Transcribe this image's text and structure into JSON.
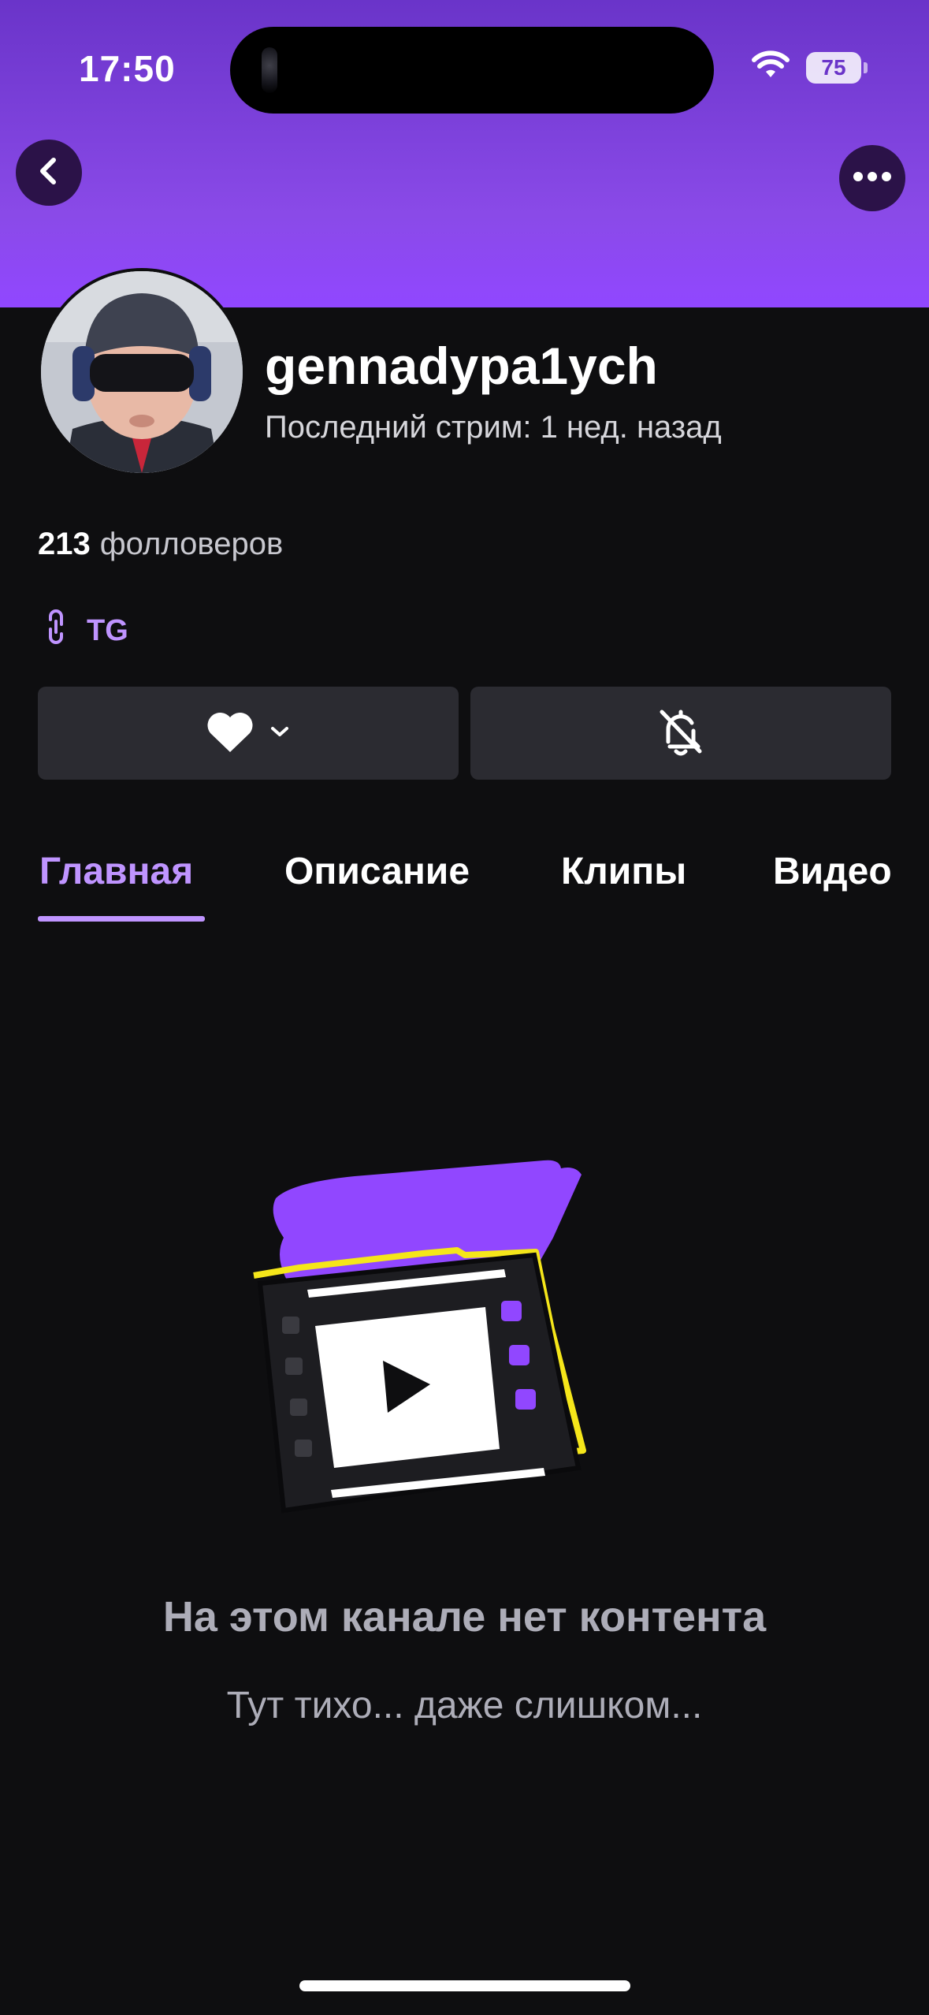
{
  "status_bar": {
    "time": "17:50",
    "battery": "75"
  },
  "profile": {
    "username": "gennadypa1ych",
    "last_stream": "Последний стрим: 1 нед. назад",
    "followers_count": "213",
    "followers_label": "фолловеров",
    "link_label": "TG"
  },
  "tabs": [
    {
      "label": "Главная",
      "active": true
    },
    {
      "label": "Описание",
      "active": false
    },
    {
      "label": "Клипы",
      "active": false
    },
    {
      "label": "Видео",
      "active": false
    }
  ],
  "empty_state": {
    "title": "На этом канале нет контента",
    "subtitle": "Тут тихо... даже слишком..."
  },
  "colors": {
    "accent": "#bf94ff",
    "brand_purple": "#9147ff",
    "background": "#0e0e10",
    "button_bg": "#2b2b31",
    "illustration_yellow": "#f5e61a"
  },
  "icons": {
    "back": "chevron-left-icon",
    "more": "more-horizontal-icon",
    "link": "link-icon",
    "follow": "heart-icon",
    "dropdown": "chevron-down-icon",
    "notifications": "bell-off-icon",
    "wifi": "wifi-icon",
    "battery": "battery-icon"
  }
}
